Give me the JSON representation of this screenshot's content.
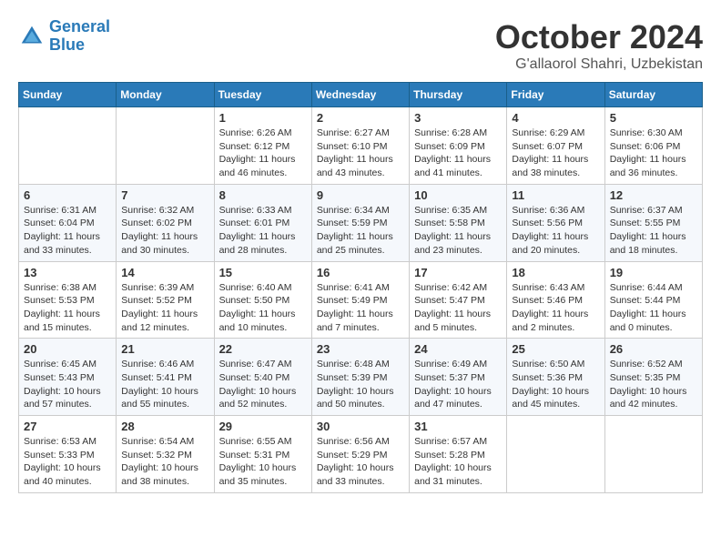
{
  "header": {
    "logo_line1": "General",
    "logo_line2": "Blue",
    "month_title": "October 2024",
    "location": "G'allaorol Shahri, Uzbekistan"
  },
  "weekdays": [
    "Sunday",
    "Monday",
    "Tuesday",
    "Wednesday",
    "Thursday",
    "Friday",
    "Saturday"
  ],
  "weeks": [
    [
      null,
      null,
      {
        "day": 1,
        "sunrise": "6:26 AM",
        "sunset": "6:12 PM",
        "daylight": "11 hours and 46 minutes."
      },
      {
        "day": 2,
        "sunrise": "6:27 AM",
        "sunset": "6:10 PM",
        "daylight": "11 hours and 43 minutes."
      },
      {
        "day": 3,
        "sunrise": "6:28 AM",
        "sunset": "6:09 PM",
        "daylight": "11 hours and 41 minutes."
      },
      {
        "day": 4,
        "sunrise": "6:29 AM",
        "sunset": "6:07 PM",
        "daylight": "11 hours and 38 minutes."
      },
      {
        "day": 5,
        "sunrise": "6:30 AM",
        "sunset": "6:06 PM",
        "daylight": "11 hours and 36 minutes."
      }
    ],
    [
      {
        "day": 6,
        "sunrise": "6:31 AM",
        "sunset": "6:04 PM",
        "daylight": "11 hours and 33 minutes."
      },
      {
        "day": 7,
        "sunrise": "6:32 AM",
        "sunset": "6:02 PM",
        "daylight": "11 hours and 30 minutes."
      },
      {
        "day": 8,
        "sunrise": "6:33 AM",
        "sunset": "6:01 PM",
        "daylight": "11 hours and 28 minutes."
      },
      {
        "day": 9,
        "sunrise": "6:34 AM",
        "sunset": "5:59 PM",
        "daylight": "11 hours and 25 minutes."
      },
      {
        "day": 10,
        "sunrise": "6:35 AM",
        "sunset": "5:58 PM",
        "daylight": "11 hours and 23 minutes."
      },
      {
        "day": 11,
        "sunrise": "6:36 AM",
        "sunset": "5:56 PM",
        "daylight": "11 hours and 20 minutes."
      },
      {
        "day": 12,
        "sunrise": "6:37 AM",
        "sunset": "5:55 PM",
        "daylight": "11 hours and 18 minutes."
      }
    ],
    [
      {
        "day": 13,
        "sunrise": "6:38 AM",
        "sunset": "5:53 PM",
        "daylight": "11 hours and 15 minutes."
      },
      {
        "day": 14,
        "sunrise": "6:39 AM",
        "sunset": "5:52 PM",
        "daylight": "11 hours and 12 minutes."
      },
      {
        "day": 15,
        "sunrise": "6:40 AM",
        "sunset": "5:50 PM",
        "daylight": "11 hours and 10 minutes."
      },
      {
        "day": 16,
        "sunrise": "6:41 AM",
        "sunset": "5:49 PM",
        "daylight": "11 hours and 7 minutes."
      },
      {
        "day": 17,
        "sunrise": "6:42 AM",
        "sunset": "5:47 PM",
        "daylight": "11 hours and 5 minutes."
      },
      {
        "day": 18,
        "sunrise": "6:43 AM",
        "sunset": "5:46 PM",
        "daylight": "11 hours and 2 minutes."
      },
      {
        "day": 19,
        "sunrise": "6:44 AM",
        "sunset": "5:44 PM",
        "daylight": "11 hours and 0 minutes."
      }
    ],
    [
      {
        "day": 20,
        "sunrise": "6:45 AM",
        "sunset": "5:43 PM",
        "daylight": "10 hours and 57 minutes."
      },
      {
        "day": 21,
        "sunrise": "6:46 AM",
        "sunset": "5:41 PM",
        "daylight": "10 hours and 55 minutes."
      },
      {
        "day": 22,
        "sunrise": "6:47 AM",
        "sunset": "5:40 PM",
        "daylight": "10 hours and 52 minutes."
      },
      {
        "day": 23,
        "sunrise": "6:48 AM",
        "sunset": "5:39 PM",
        "daylight": "10 hours and 50 minutes."
      },
      {
        "day": 24,
        "sunrise": "6:49 AM",
        "sunset": "5:37 PM",
        "daylight": "10 hours and 47 minutes."
      },
      {
        "day": 25,
        "sunrise": "6:50 AM",
        "sunset": "5:36 PM",
        "daylight": "10 hours and 45 minutes."
      },
      {
        "day": 26,
        "sunrise": "6:52 AM",
        "sunset": "5:35 PM",
        "daylight": "10 hours and 42 minutes."
      }
    ],
    [
      {
        "day": 27,
        "sunrise": "6:53 AM",
        "sunset": "5:33 PM",
        "daylight": "10 hours and 40 minutes."
      },
      {
        "day": 28,
        "sunrise": "6:54 AM",
        "sunset": "5:32 PM",
        "daylight": "10 hours and 38 minutes."
      },
      {
        "day": 29,
        "sunrise": "6:55 AM",
        "sunset": "5:31 PM",
        "daylight": "10 hours and 35 minutes."
      },
      {
        "day": 30,
        "sunrise": "6:56 AM",
        "sunset": "5:29 PM",
        "daylight": "10 hours and 33 minutes."
      },
      {
        "day": 31,
        "sunrise": "6:57 AM",
        "sunset": "5:28 PM",
        "daylight": "10 hours and 31 minutes."
      },
      null,
      null
    ]
  ]
}
